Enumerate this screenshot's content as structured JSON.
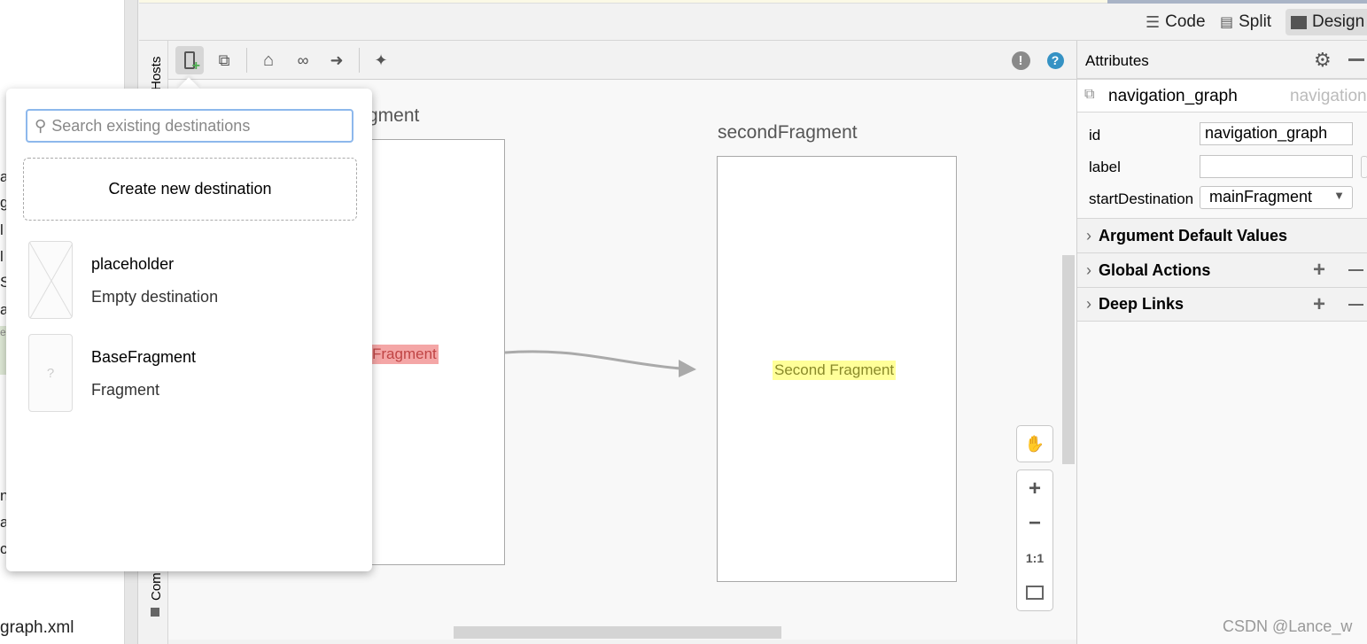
{
  "left_panel": {
    "items": [
      "a",
      "g",
      "l",
      "l",
      "S",
      "ai",
      "e",
      "n",
      "a",
      "c"
    ],
    "file": "graph.xml"
  },
  "mode_switcher": {
    "code": "Code",
    "split": "Split",
    "design": "Design",
    "selected": "Design"
  },
  "side_tabs": {
    "hosts": "Hosts",
    "component_tree": "Com"
  },
  "toolbar": {
    "icons": [
      "new-destination-icon",
      "nested-graph-icon",
      "home-icon",
      "link-icon",
      "arrow-icon",
      "magic-wand-icon",
      "warning-icon",
      "help-icon"
    ]
  },
  "canvas": {
    "main_fragment": {
      "label": "mainFragment",
      "label_visible": "gment",
      "text": "Fragment",
      "highlight": "#f4a6a6"
    },
    "second_fragment": {
      "label": "secondFragment",
      "text": "Second Fragment",
      "highlight": "#ffff99"
    },
    "zoom_controls": {
      "fit_label": "1:1"
    }
  },
  "attributes": {
    "title": "Attributes",
    "component": {
      "name": "navigation_graph",
      "type": "navigation"
    },
    "fields": {
      "id": {
        "label": "id",
        "value": "navigation_graph"
      },
      "label": {
        "label": "label",
        "value": ""
      },
      "startDestination": {
        "label": "startDestination",
        "value": "mainFragment"
      }
    },
    "sections": [
      "Argument Default Values",
      "Global Actions",
      "Deep Links"
    ]
  },
  "popup": {
    "search_placeholder": "Search existing destinations",
    "create_label": "Create new destination",
    "destinations": [
      {
        "name": "placeholder",
        "type": "Empty destination"
      },
      {
        "name": "BaseFragment",
        "type": "Fragment"
      }
    ]
  },
  "watermark": "CSDN @Lance_w",
  "colors": {
    "accent_focus": "#8db8ec",
    "help": "#3592c4",
    "add_green": "#4caf50"
  }
}
